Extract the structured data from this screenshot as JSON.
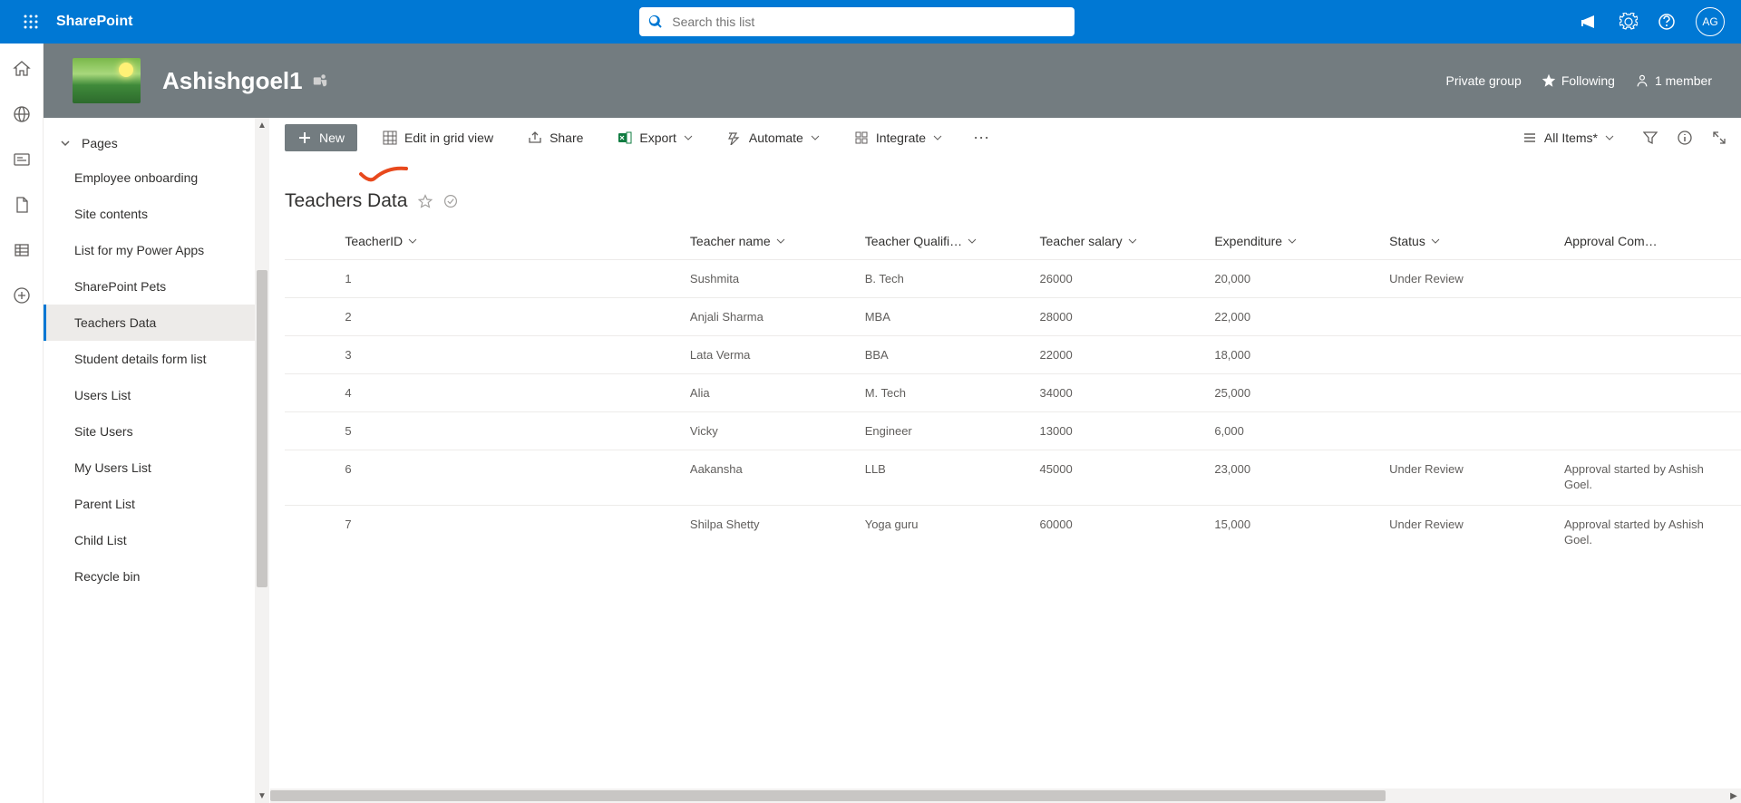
{
  "header": {
    "app_name": "SharePoint",
    "search_placeholder": "Search this list",
    "avatar_initials": "AG"
  },
  "site": {
    "title": "Ashishgoel1",
    "privacy": "Private group",
    "following": "Following",
    "members": "1 member"
  },
  "nav": {
    "section": "Pages",
    "items": [
      {
        "label": "Employee onboarding"
      },
      {
        "label": "Site contents"
      },
      {
        "label": "List for my Power Apps"
      },
      {
        "label": "SharePoint Pets"
      },
      {
        "label": "Teachers Data"
      },
      {
        "label": "Student details form list"
      },
      {
        "label": "Users List"
      },
      {
        "label": "Site Users"
      },
      {
        "label": "My Users List"
      },
      {
        "label": "Parent List"
      },
      {
        "label": "Child List"
      },
      {
        "label": "Recycle bin"
      }
    ]
  },
  "commands": {
    "new": "New",
    "edit_grid": "Edit in grid view",
    "share": "Share",
    "export": "Export",
    "automate": "Automate",
    "integrate": "Integrate",
    "view_name": "All Items*"
  },
  "list": {
    "title": "Teachers Data",
    "columns": [
      "TeacherID",
      "Teacher name",
      "Teacher Qualifi…",
      "Teacher salary",
      "Expenditure",
      "Status",
      "Approval Com…"
    ],
    "rows": [
      {
        "id": "1",
        "name": "Sushmita",
        "qual": "B. Tech",
        "salary": "26000",
        "exp": "20,000",
        "status": "Under Review",
        "approval": ""
      },
      {
        "id": "2",
        "name": "Anjali Sharma",
        "qual": "MBA",
        "salary": "28000",
        "exp": "22,000",
        "status": "",
        "approval": ""
      },
      {
        "id": "3",
        "name": "Lata Verma",
        "qual": "BBA",
        "salary": "22000",
        "exp": "18,000",
        "status": "",
        "approval": ""
      },
      {
        "id": "4",
        "name": "Alia",
        "qual": "M. Tech",
        "salary": "34000",
        "exp": "25,000",
        "status": "",
        "approval": ""
      },
      {
        "id": "5",
        "name": "Vicky",
        "qual": "Engineer",
        "salary": "13000",
        "exp": "6,000",
        "status": "",
        "approval": ""
      },
      {
        "id": "6",
        "name": "Aakansha",
        "qual": "LLB",
        "salary": "45000",
        "exp": "23,000",
        "status": "Under Review",
        "approval": "Approval started by Ashish Goel."
      },
      {
        "id": "7",
        "name": "Shilpa Shetty",
        "qual": "Yoga guru",
        "salary": "60000",
        "exp": "15,000",
        "status": "Under Review",
        "approval": "Approval started by Ashish Goel."
      }
    ]
  }
}
